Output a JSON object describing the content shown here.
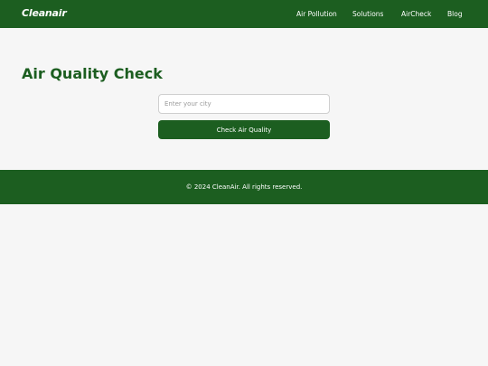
{
  "header": {
    "logo_text": "Cleanair",
    "nav": [
      {
        "label": "Air Pollution"
      },
      {
        "label": "Solutions"
      },
      {
        "label": "AirCheck"
      },
      {
        "label": "Blog"
      }
    ]
  },
  "main": {
    "title": "Air Quality Check",
    "city_input": {
      "placeholder": "Enter your city",
      "value": ""
    },
    "check_button_label": "Check Air Quality"
  },
  "footer": {
    "copyright": "© 2024 CleanAir. All rights reserved."
  },
  "colors": {
    "brand_green": "#1c5e20",
    "page_background": "#f6f6f6"
  }
}
